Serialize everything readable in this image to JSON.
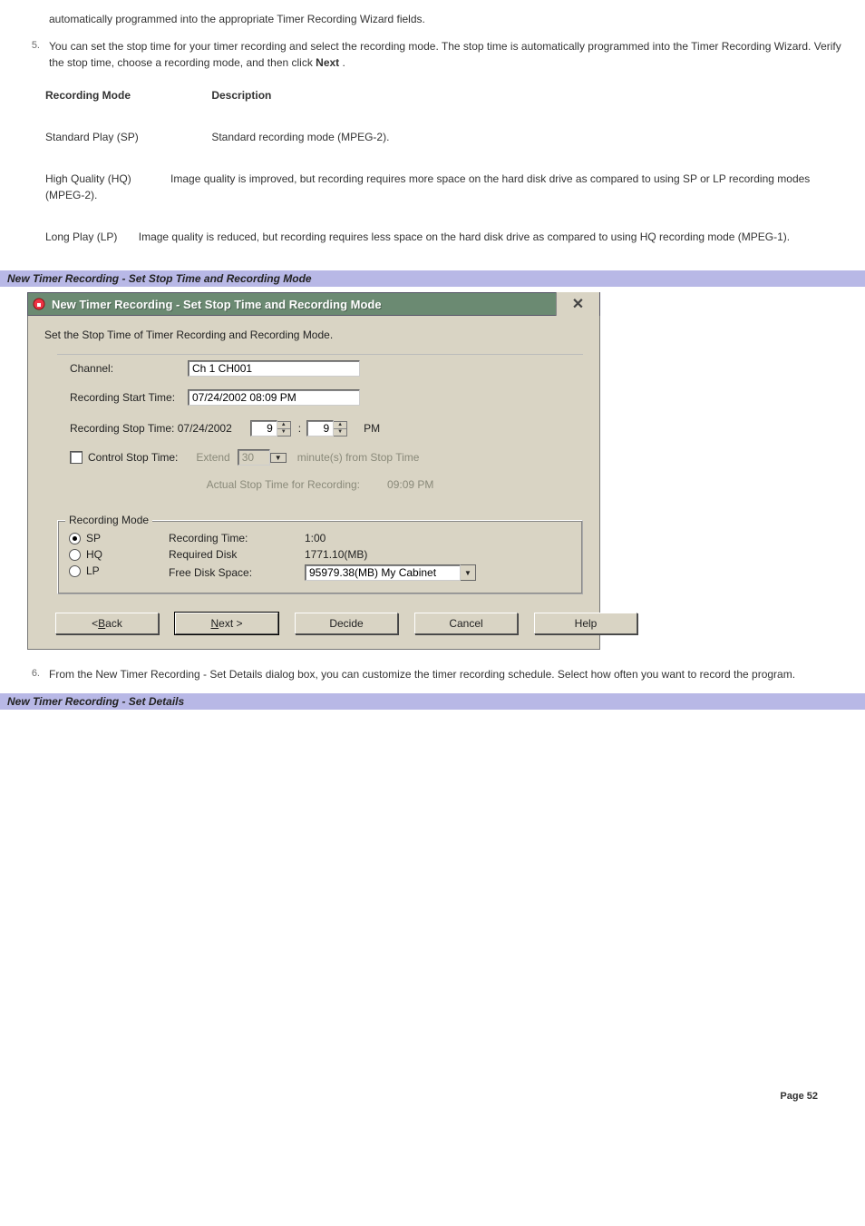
{
  "intro_continued": "automatically programmed into the appropriate Timer Recording Wizard fields.",
  "step5": {
    "num": "5.",
    "text_before": "You can set the stop time for your timer recording and select the recording mode. The stop time is automatically programmed into the Timer Recording Wizard. Verify the stop time, choose a recording mode, and then click ",
    "bold": "Next",
    "text_after": " ."
  },
  "mode_table": {
    "h1": "Recording Mode",
    "h2": "Description",
    "rows": [
      {
        "name": "Standard Play (SP)",
        "desc": "Standard recording mode (MPEG-2)."
      },
      {
        "name": "High Quality (HQ)",
        "desc": "Image quality is improved, but recording requires more space on the hard disk drive as compared to using SP or LP recording modes (MPEG-2)."
      },
      {
        "name": "Long Play (LP)",
        "desc": "Image quality is reduced, but recording requires less space on the hard disk drive as compared to using HQ recording mode (MPEG-1)."
      }
    ]
  },
  "caption1": "New Timer Recording - Set Stop Time and Recording Mode",
  "dialog": {
    "title": "New Timer Recording - Set Stop Time and Recording Mode",
    "intro": "Set the Stop Time of Timer Recording and Recording Mode.",
    "channel_lbl": "Channel:",
    "channel_val": "Ch 1 CH001",
    "start_lbl": "Recording Start Time:",
    "start_val": "07/24/2002 08:09 PM",
    "stop_lbl": "Recording Stop Time: 07/24/2002",
    "stop_h": "9",
    "stop_m": "9",
    "stop_ampm": "PM",
    "ctrl_lbl": "Control Stop Time:",
    "extend_lbl": "Extend",
    "extend_val": "30",
    "extend_suffix": "minute(s) from Stop Time",
    "actual_lbl": "Actual Stop Time for Recording:",
    "actual_val": "09:09 PM",
    "group_title": "Recording Mode",
    "radios": {
      "sp": "SP",
      "hq": "HQ",
      "lp": "LP"
    },
    "rec_time_lbl": "Recording Time:",
    "rec_time_val": "1:00",
    "req_disk_lbl": "Required Disk",
    "req_disk_val": "1771.10(MB)",
    "free_lbl": "Free Disk Space:",
    "free_val": "95979.38(MB) My Cabinet",
    "buttons": {
      "back_u": "B",
      "back_rest": "ack",
      "next_u": "N",
      "next_rest": "ext >",
      "decide": "Decide",
      "cancel": "Cancel",
      "help": "Help",
      "lt": "< "
    }
  },
  "step6": {
    "num": "6.",
    "text": "From the New Timer Recording - Set Details dialog box, you can customize the timer recording schedule. Select how often you want to record the program."
  },
  "caption2": "New Timer Recording - Set Details",
  "footer": "Page 52"
}
